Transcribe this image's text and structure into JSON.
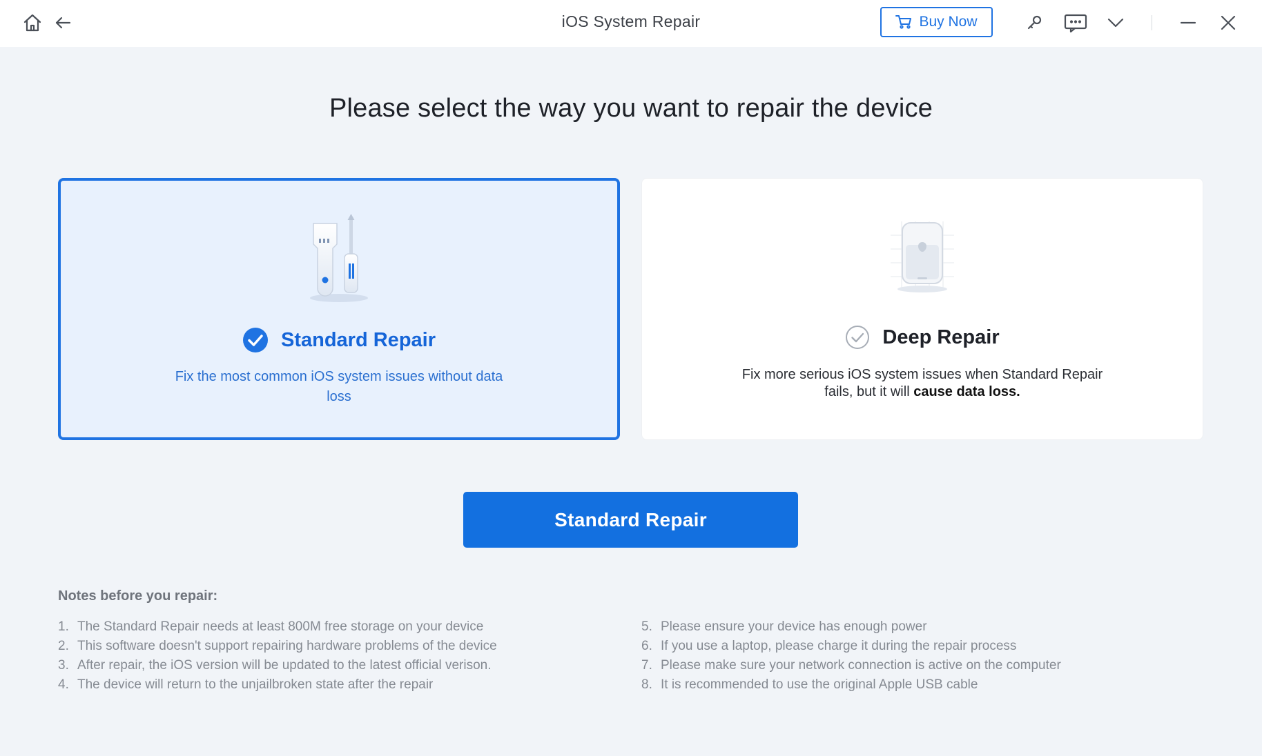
{
  "window": {
    "title": "iOS System Repair",
    "buy_label": "Buy Now",
    "icons": [
      "home-icon",
      "back-arrow-icon",
      "cart-icon",
      "key-icon",
      "feedback-icon",
      "chevron-down-icon",
      "minimize-icon",
      "close-icon"
    ]
  },
  "heading": "Please select the way you want to repair the device",
  "options": {
    "standard": {
      "name": "Standard Repair",
      "description": "Fix the most common iOS system issues without data loss",
      "selected": true
    },
    "deep": {
      "name": "Deep Repair",
      "description_prefix": "Fix more serious iOS system issues when Standard Repair fails, but it will ",
      "description_emphasis": "cause data loss.",
      "selected": false
    }
  },
  "action_button": "Standard Repair",
  "notes": {
    "title": "Notes before you repair:",
    "left": [
      {
        "num": "1.",
        "text": "The Standard Repair needs at least 800M free storage on your device"
      },
      {
        "num": "2.",
        "text": "This software doesn't support repairing hardware problems of the device"
      },
      {
        "num": "3.",
        "text": "After repair, the iOS version will be updated to the latest official verison."
      },
      {
        "num": "4.",
        "text": "The device will return to the unjailbroken state after the repair"
      }
    ],
    "right": [
      {
        "num": "5.",
        "text": "Please ensure your device has enough power"
      },
      {
        "num": "6.",
        "text": "If you use a laptop, please charge it during the repair process"
      },
      {
        "num": "7.",
        "text": "Please make sure your network connection is active on the computer"
      },
      {
        "num": "8.",
        "text": "It is recommended to use the original Apple USB cable"
      }
    ]
  },
  "colors": {
    "accent": "#1f73e2",
    "selected_bg": "#e8f1fd",
    "page_bg": "#f1f4f8"
  }
}
